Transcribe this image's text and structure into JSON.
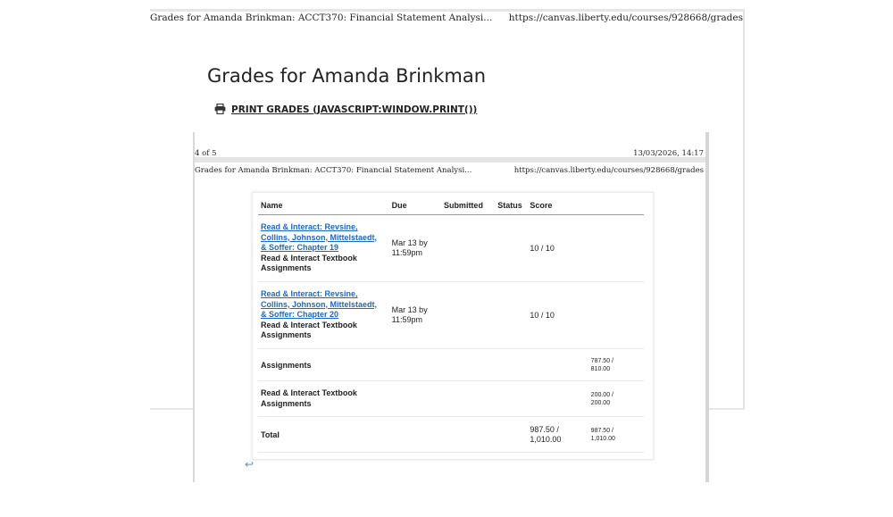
{
  "print_header": {
    "left": "Grades for Amanda Brinkman: ACCT370: Financial Statement Analysi...",
    "right": "https://canvas.liberty.edu/courses/928668/grades"
  },
  "page_title": "Grades for Amanda Brinkman",
  "print_link": "PRINT GRADES (JAVASCRIPT:WINDOW.PRINT())",
  "inner_page": {
    "page_number": "4 of 5",
    "datetime": "13/03/2026, 14:17",
    "header_left": "Grades for Amanda Brinkman: ACCT370: Financial Statement Analysi...",
    "header_right": "https://canvas.liberty.edu/courses/928668/grades"
  },
  "table": {
    "headers": [
      "Name",
      "Due",
      "Submitted",
      "Status",
      "Score"
    ],
    "assignments": [
      {
        "title_lines": [
          "Read & Interact: Revsine,",
          "Collins, Johnson, Mittelstaedt,",
          "& Soffer: Chapter 19"
        ],
        "category_lines": [
          "Read & Interact Textbook",
          "Assignments"
        ],
        "due_lines": [
          "Mar 13 by",
          "11:59pm"
        ],
        "score": "10 / 10"
      },
      {
        "title_lines": [
          "Read & Interact: Revsine,",
          "Collins, Johnson, Mittelstaedt,",
          "& Soffer: Chapter 20"
        ],
        "category_lines": [
          "Read & Interact Textbook",
          "Assignments"
        ],
        "due_lines": [
          "Mar 13 by",
          "11:59pm"
        ],
        "score": "10 / 10"
      }
    ],
    "groups": [
      {
        "name_lines": [
          "Assignments"
        ],
        "total_lines": [
          "787.50 /",
          "810.00"
        ]
      },
      {
        "name_lines": [
          "Read & Interact Textbook",
          "Assignments"
        ],
        "total_lines": [
          "200.00 /",
          "200.00"
        ]
      }
    ],
    "total": {
      "label": "Total",
      "score_lines": [
        "987.50 /",
        "1,010.00"
      ],
      "total_lines": [
        "987.50 /",
        "1,010.00"
      ]
    }
  }
}
